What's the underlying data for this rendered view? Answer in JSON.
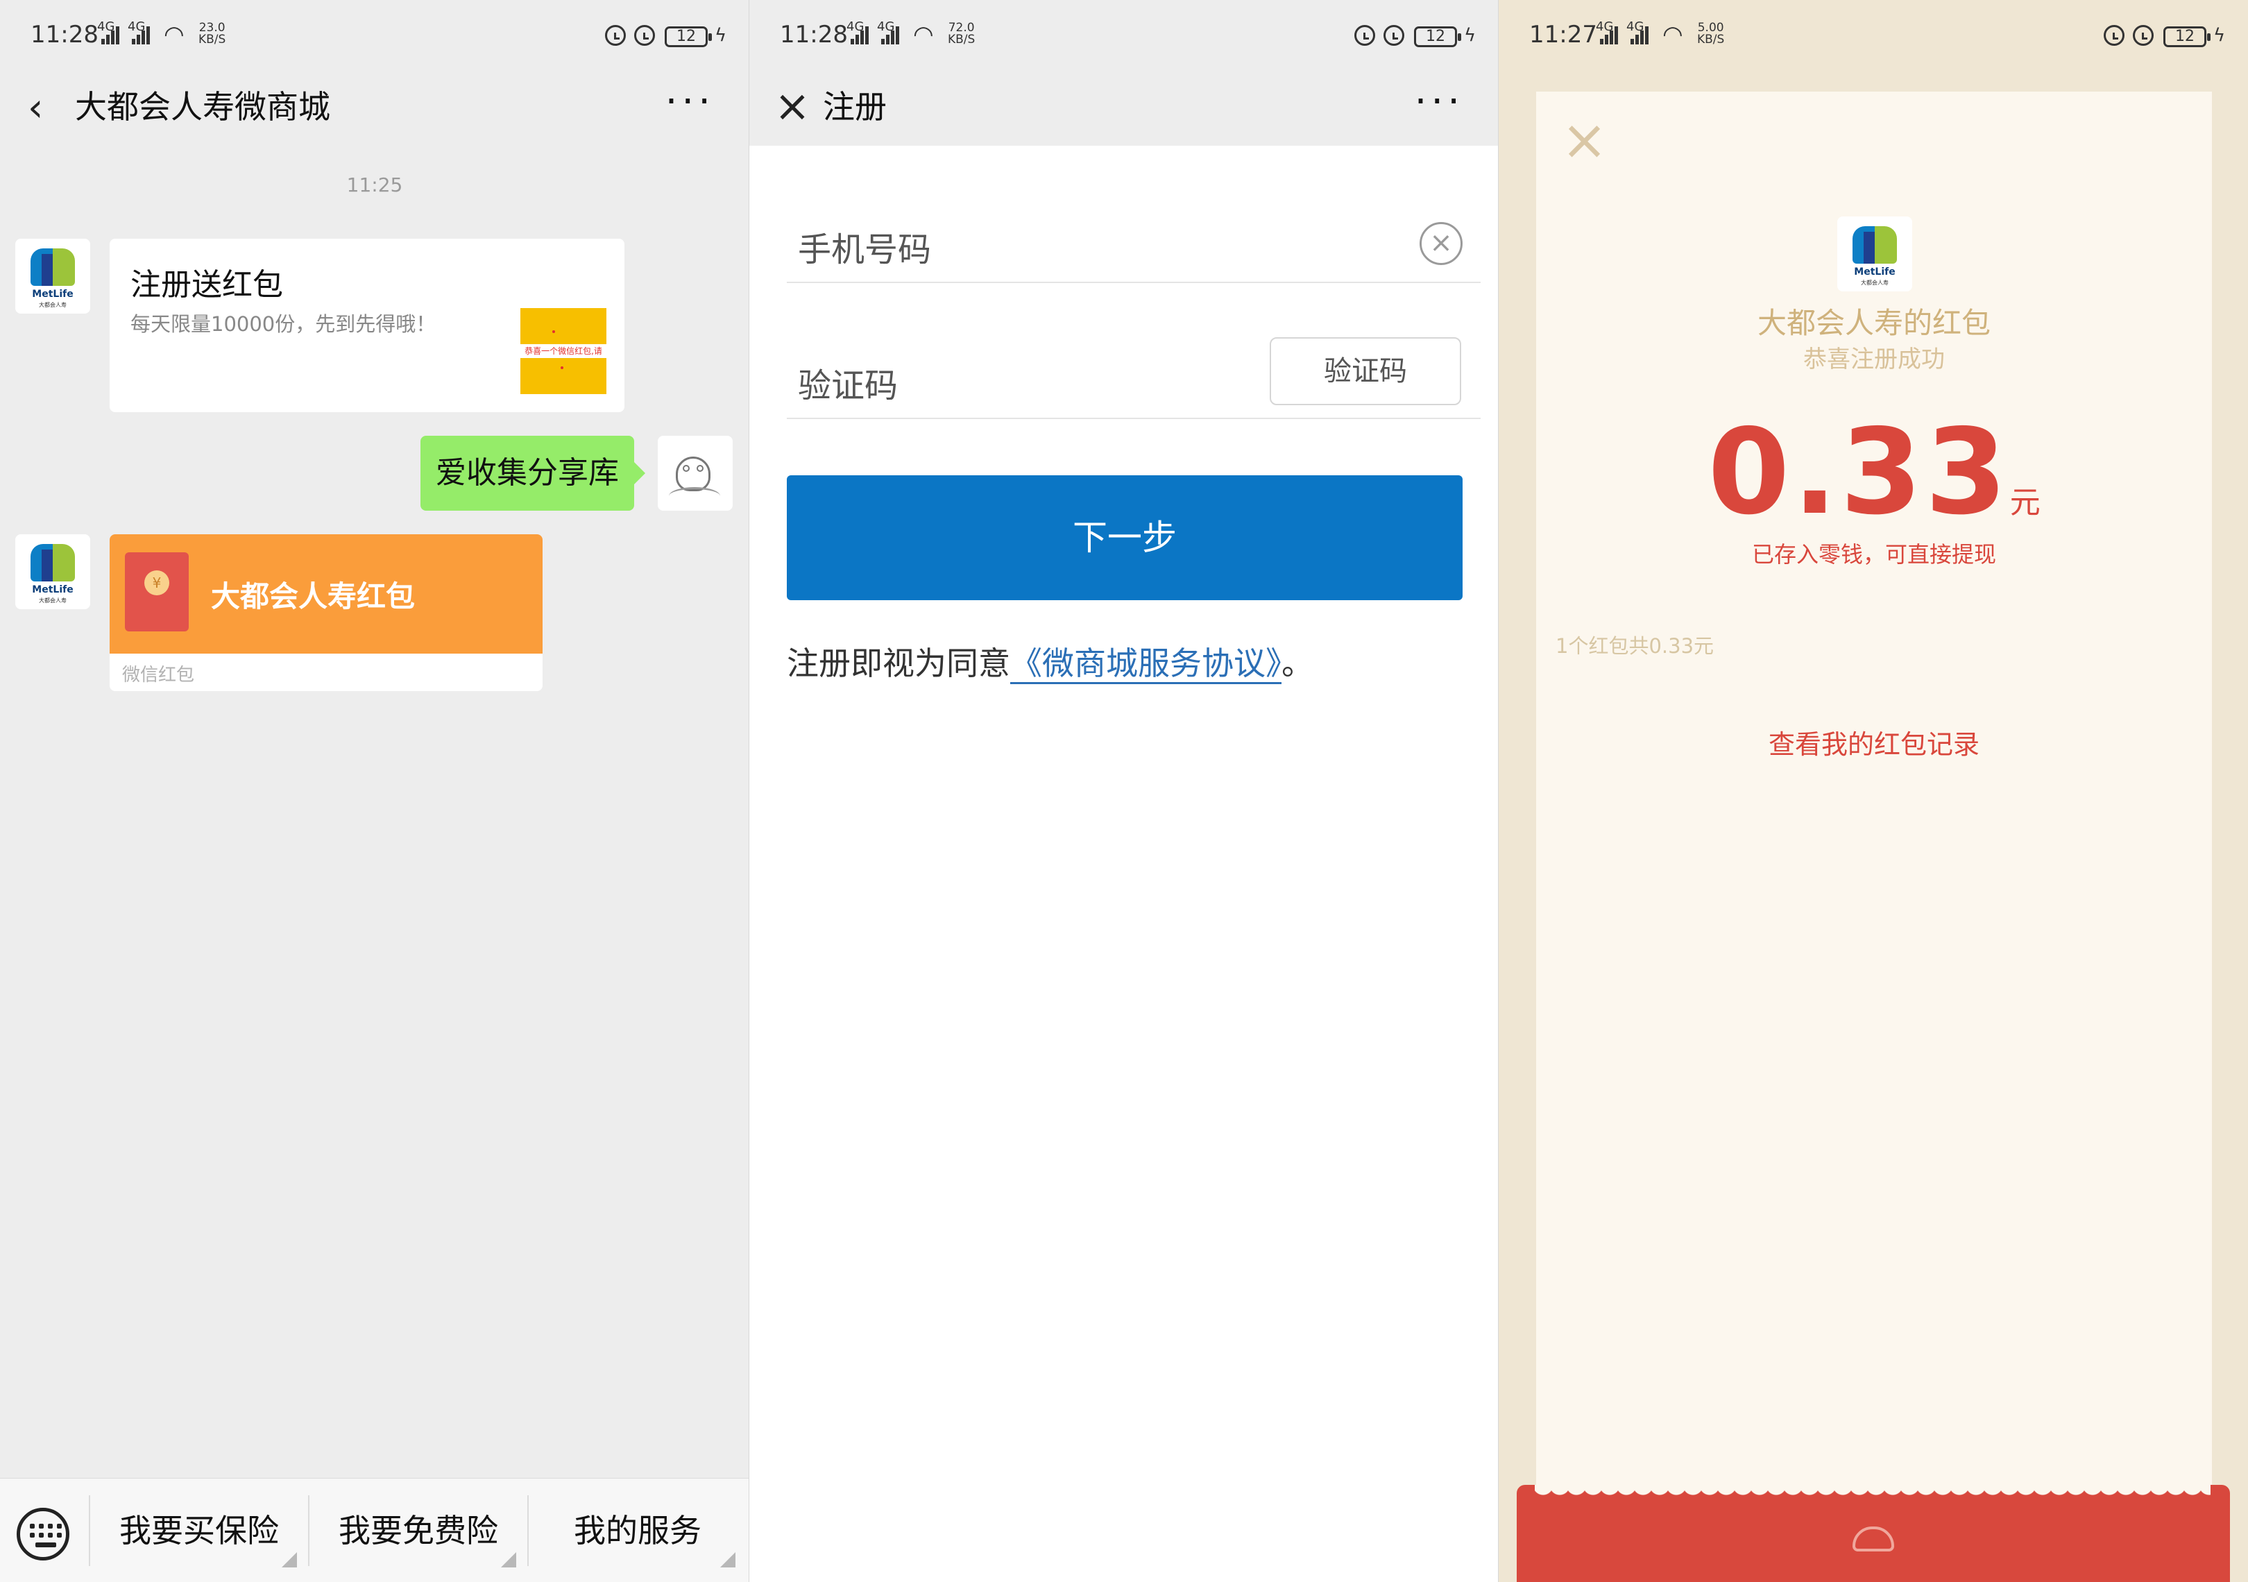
{
  "panel1": {
    "status": {
      "time": "11:28",
      "net1": "4G",
      "net2": "4G",
      "speed_val": "23.0",
      "speed_unit": "KB/S",
      "battery": "12"
    },
    "title": "大都会人寿微商城",
    "timestamp": "11:25",
    "card": {
      "title": "注册送红包",
      "desc": "每天限量10000份，先到先得哦！",
      "thumb_text": "恭喜一个微信红包,请",
      "logo_text": "MetLife",
      "logo_sub": "大都会人寿"
    },
    "user_message": "爱收集分享库",
    "red_packet": {
      "title": "大都会人寿红包",
      "coin": "¥",
      "footer": "微信红包"
    },
    "menu": [
      "我要买保险",
      "我要免费险",
      "我的服务"
    ]
  },
  "panel2": {
    "status": {
      "time": "11:28",
      "net1": "4G",
      "net2": "4G",
      "speed_val": "72.0",
      "speed_unit": "KB/S",
      "battery": "12"
    },
    "title": "注册",
    "phone_placeholder": "手机号码",
    "code_placeholder": "验证码",
    "code_button": "验证码",
    "next_button": "下一步",
    "agree_prefix": "注册即视为同意",
    "agree_link": "《微商城服务协议》",
    "agree_suffix": "。"
  },
  "panel3": {
    "status": {
      "time": "11:27",
      "net1": "4G",
      "net2": "4G",
      "speed_val": "5.00",
      "speed_unit": "KB/S",
      "battery": "12"
    },
    "sender": "大都会人寿的红包",
    "subtitle": "恭喜注册成功",
    "amount": "0.33",
    "unit": "元",
    "note": "已存入零钱，可直接提现",
    "count": "1个红包共0.33元",
    "link": "查看我的红包记录",
    "logo_text": "MetLife",
    "logo_sub": "大都会人寿"
  },
  "colors": {
    "wechat_green": "#95ec69",
    "red_packet_orange": "#fa9d3b",
    "primary_blue": "#0b76c5",
    "packet_red": "#d9473c"
  }
}
